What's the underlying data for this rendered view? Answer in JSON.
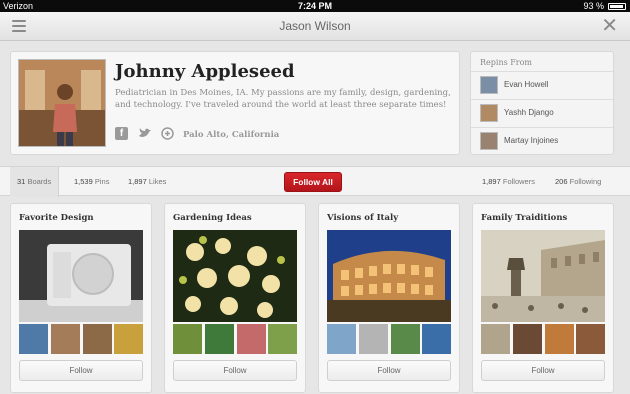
{
  "status": {
    "carrier": "Verizon",
    "time": "7:24 PM",
    "battery": "93 %"
  },
  "header": {
    "title": "Jason Wilson"
  },
  "profile": {
    "name": "Johnny Appleseed",
    "bio": "Pediatrician in Des Moines, IA. My passions are my family, design, gardening, and technology. I've traveled around the world at least three separate times!",
    "location": "Palo Alto, California"
  },
  "repins": {
    "title": "Repins From",
    "people": [
      {
        "name": "Evan Howell",
        "color": "#7a8ea6"
      },
      {
        "name": "Yashh Django",
        "color": "#b08a62"
      },
      {
        "name": "Martay Injoines",
        "color": "#9a8270"
      }
    ]
  },
  "stats": {
    "boards_count": "31",
    "boards_label": "Boards",
    "pins_count": "1,539",
    "pins_label": "Pins",
    "likes_count": "1,897",
    "likes_label": "Likes",
    "follow_all": "Follow All",
    "followers_count": "1,897",
    "followers_label": "Followers",
    "following_count": "206",
    "following_label": "Following"
  },
  "boards": [
    {
      "title": "Favorite Design",
      "follow": "Follow"
    },
    {
      "title": "Gardening Ideas",
      "follow": "Follow"
    },
    {
      "title": "Visions of Italy",
      "follow": "Follow"
    },
    {
      "title": "Family Traiditions",
      "follow": "Follow"
    }
  ],
  "colors": {
    "accent_red": "#c41b20"
  }
}
